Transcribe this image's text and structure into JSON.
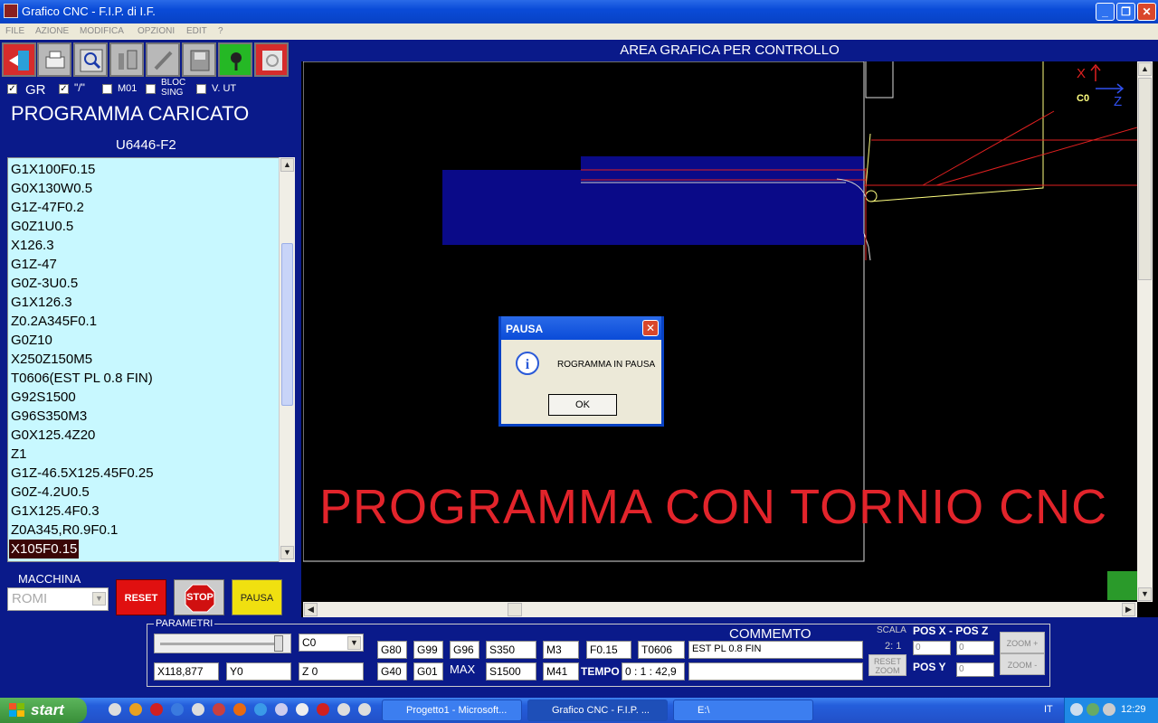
{
  "window": {
    "title": "Grafico CNC - F.I.P. di I.F."
  },
  "menu": [
    "FILE",
    "AZIONE",
    "MODIFICA",
    "OPZIONI",
    "EDIT",
    "?"
  ],
  "toolbar_icons": [
    "exit-icon",
    "printer-icon",
    "magnifier-icon",
    "tools-icon",
    "pencil-icon",
    "save-icon",
    "mic-icon",
    "recycle-icon"
  ],
  "options": {
    "gr": "GR",
    "slash": "\"/\"",
    "m01": "M01",
    "bloc": "BLOC SING",
    "vut": "V. UT"
  },
  "program": {
    "title": "PROGRAMMA CARICATO",
    "name": "U6446-F2",
    "lines": [
      "G1X100F0.15",
      "G0X130W0.5",
      "G1Z-47F0.2",
      "G0Z1U0.5",
      "X126.3",
      "G1Z-47",
      "G0Z-3U0.5",
      "G1X126.3",
      "Z0.2A345F0.1",
      "G0Z10",
      "X250Z150M5",
      "T0606(EST PL 0.8 FIN)",
      "G92S1500",
      "G96S350M3",
      "G0X125.4Z20",
      "Z1",
      "G1Z-46.5X125.45F0.25",
      "G0Z-4.2U0.5",
      "G1X125.4F0.3",
      "Z0A345,R0.9F0.1",
      "X105F0.15"
    ],
    "selected": "X105F0.15"
  },
  "machine": {
    "label": "MACCHINA",
    "value": "ROMI"
  },
  "buttons": {
    "reset": "RESET",
    "stop": "STOP",
    "pausa": "PAUSA"
  },
  "graphic": {
    "header": "AREA GRAFICA PER CONTROLLO",
    "axis_x": "X",
    "axis_z": "Z",
    "axis_c": "C0",
    "overlay_text": "PROGRAMMA CON TORNIO  CNC"
  },
  "dialog": {
    "title": "PAUSA",
    "message": "ROGRAMMA IN PAUSA",
    "ok": "OK"
  },
  "params": {
    "label": "PARAMETRI",
    "c_select": "C0",
    "x_value": "X118,877",
    "y_value": "Y0",
    "z_value": "Z 0",
    "g_codes_top": [
      "G80",
      "G99",
      "G96"
    ],
    "g_codes_bottom": [
      "G40",
      "G01"
    ],
    "s_value": "S350",
    "max_label": "MAX",
    "s_max": "S1500",
    "m3": "M3",
    "m41": "M41",
    "feed": "F0.15",
    "tool": "T0606",
    "tempo_label": "TEMPO",
    "tempo_value": "0 : 1 : 42,9",
    "comment_label": "COMMEMTO",
    "comment_value": "EST PL 0.8 FIN",
    "comment_value2": "",
    "scala_label": "SCALA",
    "scala_value": "2: 1",
    "reset_zoom": "RESET ZOOM",
    "pos_xz_label": "POS X - POS Z",
    "pos_x": "0",
    "pos_z": "0",
    "pos_y_label": "POS Y",
    "pos_y": "0",
    "zoom_plus": "ZOOM +",
    "zoom_minus": "ZOOM -"
  },
  "taskbar": {
    "start": "start",
    "tasks": [
      "Progetto1 - Microsoft...",
      "Grafico CNC - F.I.P. ...",
      "E:\\"
    ],
    "lang": "IT",
    "clock": "12:29"
  }
}
